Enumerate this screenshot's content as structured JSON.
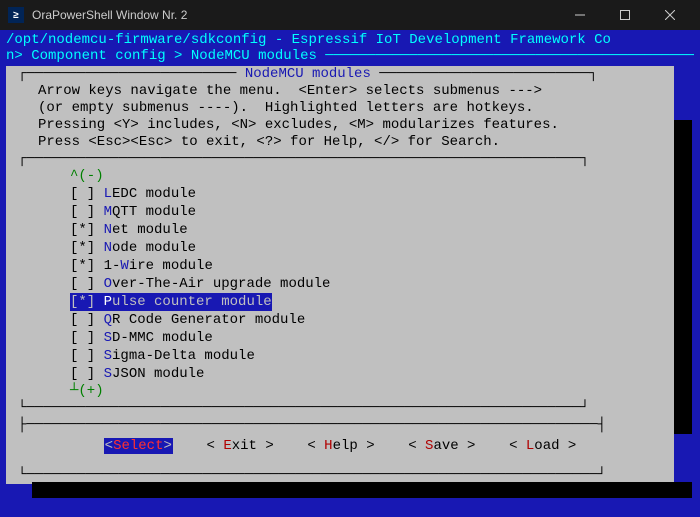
{
  "window": {
    "title": "OraPowerShell Window Nr. 2"
  },
  "header": {
    "path": "/opt/nodemcu-firmware/sdkconfig - Espressif IoT Development Framework Co",
    "breadcrumb_prefix": "n> ",
    "breadcrumb_part1": "Component config",
    "breadcrumb_sep": " > ",
    "breadcrumb_part2": "NodeMCU modules"
  },
  "panel": {
    "title": "NodeMCU modules",
    "help_line1": "Arrow keys navigate the menu.  <Enter> selects submenus --->",
    "help_line2": "(or empty submenus ----).  Highlighted letters are hotkeys.",
    "help_line3": "Pressing <Y> includes, <N> excludes, <M> modularizes features.",
    "help_line4": "Press <Esc><Esc> to exit, <?> for Help, </> for Search.",
    "scroll_up": "^(-)",
    "scroll_down": "┴(+)"
  },
  "modules": [
    {
      "marker": "[ ]",
      "hotkey": "L",
      "rest": "EDC module",
      "selected": false
    },
    {
      "marker": "[ ]",
      "hotkey": "M",
      "rest": "QTT module",
      "selected": false
    },
    {
      "marker": "[*]",
      "hotkey": "N",
      "rest": "et module",
      "selected": false
    },
    {
      "marker": "[*]",
      "hotkey": "N",
      "rest": "ode module",
      "selected": false
    },
    {
      "marker": "[*]",
      "pre": "1-",
      "hotkey": "W",
      "rest": "ire module",
      "selected": false
    },
    {
      "marker": "[ ]",
      "hotkey": "O",
      "rest": "ver-The-Air upgrade module",
      "selected": false
    },
    {
      "marker": "[*]",
      "hotkey": "P",
      "rest": "ulse counter module",
      "selected": true
    },
    {
      "marker": "[ ]",
      "hotkey": "Q",
      "rest": "R Code Generator module",
      "selected": false
    },
    {
      "marker": "[ ]",
      "hotkey": "S",
      "rest": "D-MMC module",
      "selected": false
    },
    {
      "marker": "[ ]",
      "hotkey": "S",
      "rest": "igma-Delta module",
      "selected": false
    },
    {
      "marker": "[ ]",
      "hotkey": "S",
      "rest": "JSON module",
      "selected": false
    }
  ],
  "buttons": {
    "select": "Select",
    "exit_hk": "E",
    "exit_rest": "xit",
    "help_hk": "H",
    "help_rest": "elp",
    "save_hk": "S",
    "save_rest": "ave",
    "load_hk": "L",
    "load_rest": "oad"
  }
}
